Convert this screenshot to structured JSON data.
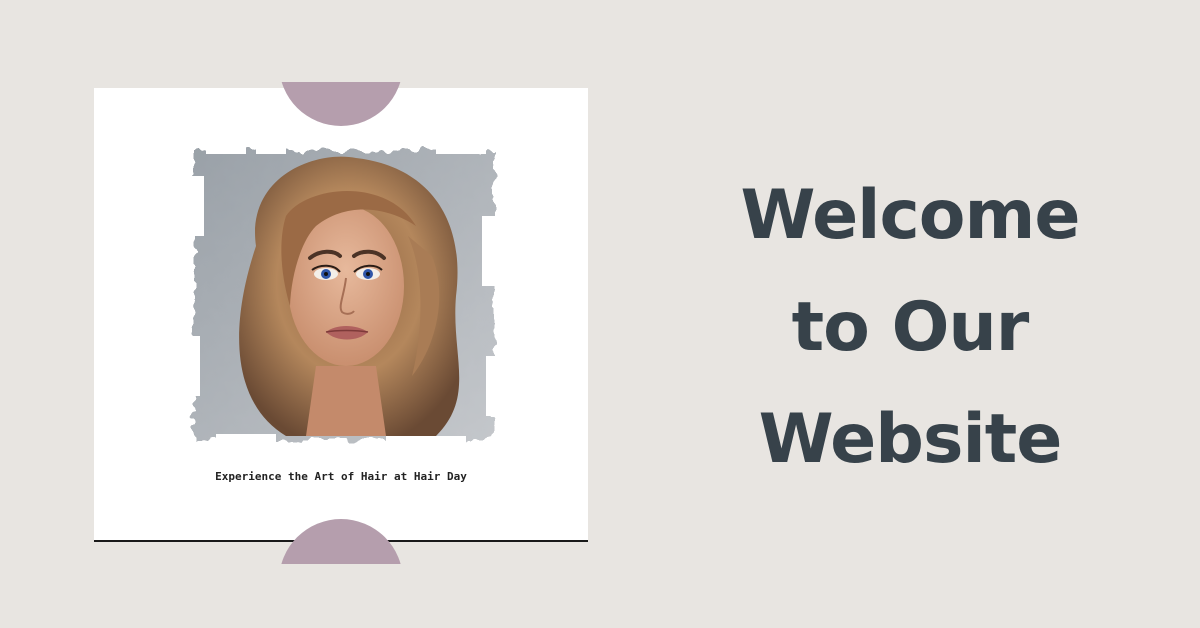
{
  "card": {
    "caption": "Experience the Art of Hair at Hair Day"
  },
  "headline": {
    "line1": "Welcome",
    "line2": "to Our",
    "line3": "Website"
  },
  "colors": {
    "background": "#e8e5e1",
    "card": "#ffffff",
    "accent": "#b59ead",
    "headline": "#37424a"
  }
}
